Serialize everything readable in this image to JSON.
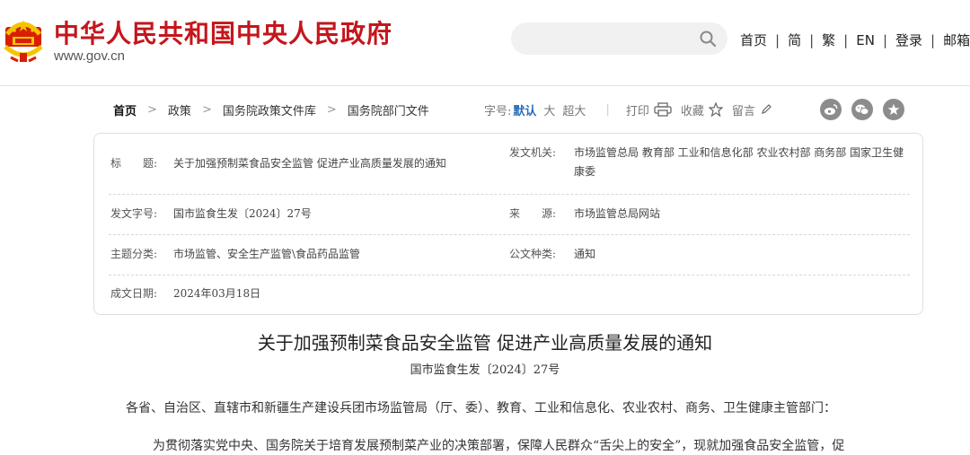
{
  "header": {
    "site_title": "中华人民共和国中央人民政府",
    "site_url": "www.gov.cn",
    "search_placeholder": "",
    "nav": [
      {
        "label": "首页"
      },
      {
        "label": "简"
      },
      {
        "label": "繁"
      },
      {
        "label": "EN"
      },
      {
        "label": "登录"
      },
      {
        "label": "邮箱"
      }
    ],
    "nav_separator": "|"
  },
  "breadcrumb": {
    "items": [
      "首页",
      "政策",
      "国务院政策文件库",
      "国务院部门文件"
    ],
    "arrow": ">"
  },
  "tools": {
    "font_size_label": "字号:",
    "font_size_default": "默认",
    "font_size_large": "大",
    "font_size_xlarge": "超大",
    "print_label": "打印",
    "favorite_label": "收藏",
    "comment_label": "留言",
    "divider": "|"
  },
  "share": [
    {
      "icon": "weibo-icon"
    },
    {
      "icon": "wechat-icon"
    },
    {
      "icon": "star-icon"
    }
  ],
  "info": {
    "title_label": "标　　题:",
    "title_value": "关于加强预制菜食品安全监管 促进产业高质量发展的通知",
    "issuer_label": "发文机关:",
    "issuer_value": "市场监管总局 教育部 工业和信息化部 农业农村部 商务部 国家卫生健康委",
    "docno_label": "发文字号:",
    "docno_value": "国市监食生发〔2024〕27号",
    "source_label": "来　　源:",
    "source_value": "市场监管总局网站",
    "category_label": "主题分类:",
    "category_value": "市场监管、安全生产监管\\食品药品监管",
    "doctype_label": "公文种类:",
    "doctype_value": "通知",
    "date_label": "成文日期:",
    "date_value": "2024年03月18日"
  },
  "article": {
    "title": "关于加强预制菜食品安全监管 促进产业高质量发展的通知",
    "doc_number": "国市监食生发〔2024〕27号",
    "addressee": "各省、自治区、直辖市和新疆生产建设兵团市场监管局（厅、委）、教育、工业和信息化、农业农村、商务、卫生健康主管部门：",
    "para1": "为贯彻落实党中央、国务院关于培育发展预制菜产业的决策部署，保障人民群众“舌尖上的安全”，现就加强食品安全监管，促"
  },
  "colors": {
    "brand_red": "#c4161c",
    "link_blue": "#2a6db6",
    "icon_gray": "#8c8c8c"
  }
}
